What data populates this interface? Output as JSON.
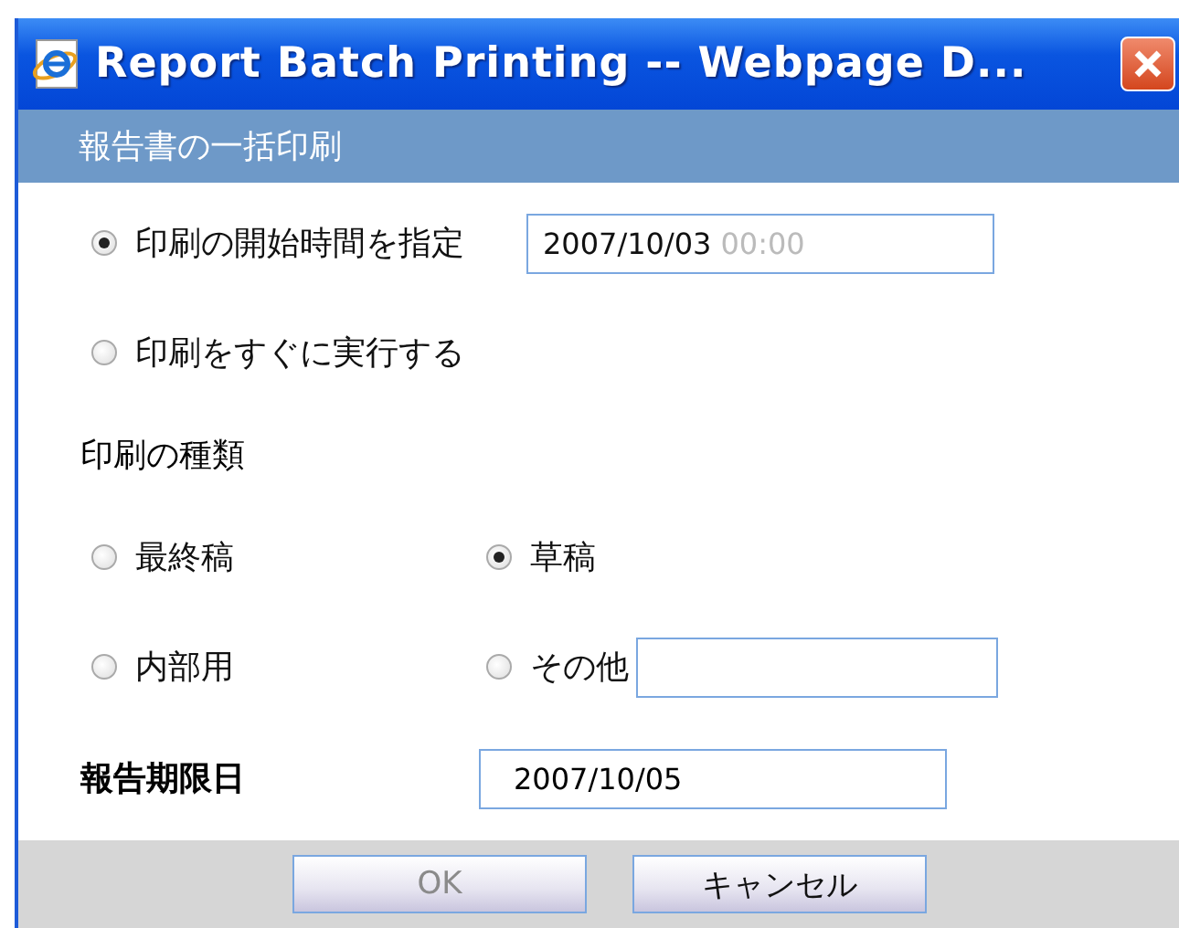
{
  "window": {
    "title": "Report Batch Printing -- Webpage D..."
  },
  "header": "報告書の一括印刷",
  "schedule_options": [
    {
      "label": "印刷の開始時間を指定",
      "selected": true,
      "kind": "datetime",
      "field": {
        "value": "2007/10/03",
        "time": "00:00"
      }
    },
    {
      "label": "印刷をすぐに実行する",
      "selected": false,
      "kind": "plain"
    }
  ],
  "print_type": {
    "label": "印刷の種類",
    "options": [
      {
        "label": "最終稿",
        "selected": false,
        "kind": "plain"
      },
      {
        "label": "草稿",
        "selected": true,
        "kind": "plain"
      },
      {
        "label": "内部用",
        "selected": false,
        "kind": "plain"
      },
      {
        "label": "その他",
        "selected": false,
        "kind": "text"
      }
    ]
  },
  "deadline": {
    "label": "報告期限日",
    "value": "2007/10/05"
  },
  "buttons": [
    {
      "label": "OK",
      "disabled": true
    },
    {
      "label": "キャンセル",
      "disabled": false
    }
  ]
}
